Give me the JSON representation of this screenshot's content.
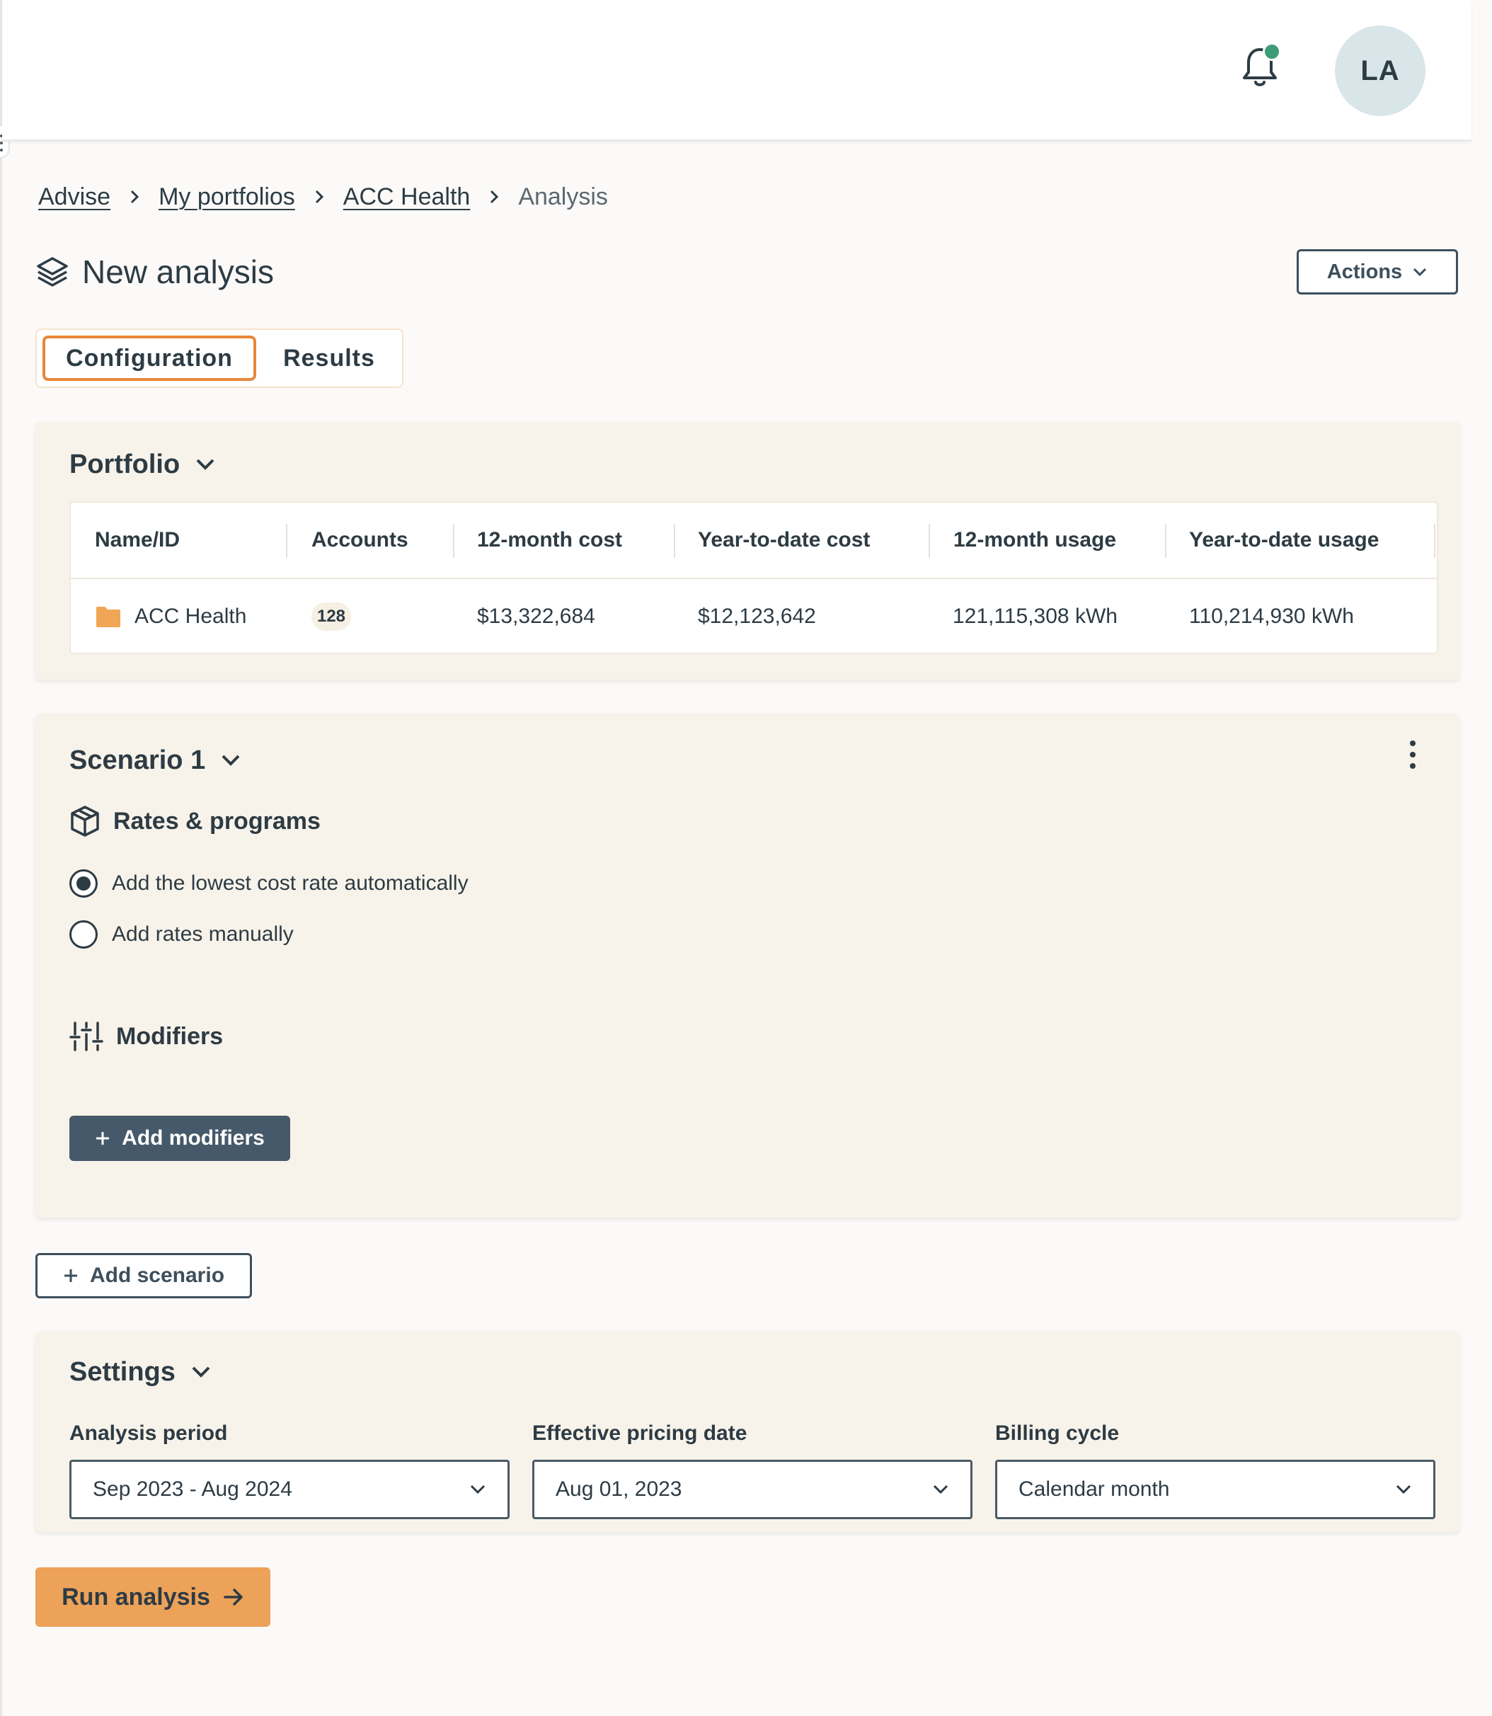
{
  "header": {
    "avatar_initials": "LA",
    "notification_dot_color": "#3e9b78"
  },
  "breadcrumb": {
    "items": [
      "Advise",
      "My portfolios",
      "ACC Health"
    ],
    "current": "Analysis"
  },
  "page": {
    "title": "New analysis",
    "actions_label": "Actions"
  },
  "tabs": [
    {
      "label": "Configuration",
      "active": true
    },
    {
      "label": "Results",
      "active": false
    }
  ],
  "portfolio": {
    "title": "Portfolio",
    "columns": [
      "Name/ID",
      "Accounts",
      "12-month cost",
      "Year-to-date cost",
      "12-month usage",
      "Year-to-date usage"
    ],
    "row": {
      "name": "ACC Health",
      "accounts": "128",
      "cost_12m": "$13,322,684",
      "cost_ytd": "$12,123,642",
      "usage_12m": "121,115,308 kWh",
      "usage_ytd": "110,214,930 kWh"
    }
  },
  "scenario": {
    "title": "Scenario 1",
    "rates_title": "Rates & programs",
    "options": [
      {
        "label": "Add the lowest cost rate automatically",
        "checked": true
      },
      {
        "label": "Add rates manually",
        "checked": false
      }
    ],
    "modifiers_title": "Modifiers",
    "add_modifiers_label": "Add modifiers"
  },
  "add_scenario_label": "Add scenario",
  "settings": {
    "title": "Settings",
    "fields": [
      {
        "label": "Analysis period",
        "value": "Sep 2023 - Aug 2024"
      },
      {
        "label": "Effective pricing date",
        "value": "Aug 01, 2023"
      },
      {
        "label": "Billing cycle",
        "value": "Calendar month"
      }
    ]
  },
  "run_label": "Run analysis",
  "colors": {
    "accent": "#e8873a",
    "run_button": "#eca259",
    "dark_button": "#46596a",
    "card_bg": "#f8f3ea",
    "folder": "#f0a656"
  }
}
